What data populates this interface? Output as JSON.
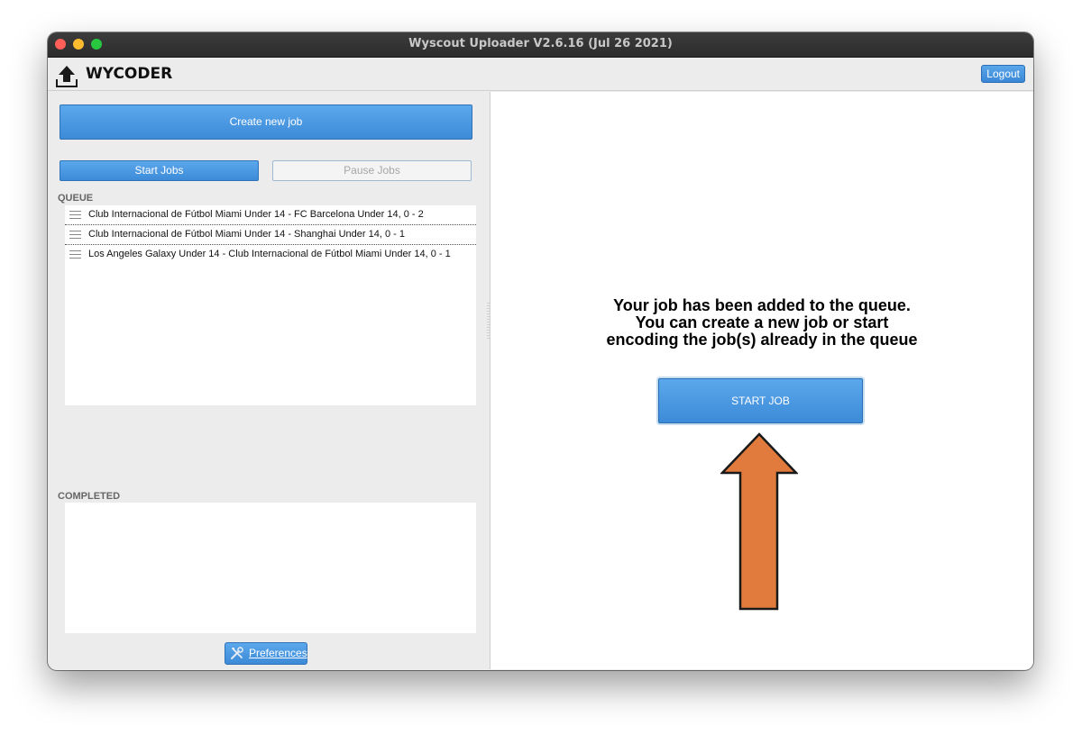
{
  "window": {
    "title": "Wyscout Uploader V2.6.16 (Jul 26 2021)"
  },
  "header": {
    "app_name": "WYCODER",
    "logo_icon": "upload-icon",
    "logout_label": "Logout"
  },
  "left_panel": {
    "create_job_label": "Create new job",
    "start_jobs_label": "Start Jobs",
    "pause_jobs_label": "Pause Jobs",
    "queue_label": "QUEUE",
    "queue_items": [
      {
        "label": "Club Internacional de Fútbol Miami Under 14 - FC Barcelona Under 14, 0 - 2"
      },
      {
        "label": "Club Internacional de Fútbol Miami Under 14 - Shanghai Under 14, 0 - 1"
      },
      {
        "label": "Los Angeles Galaxy Under 14 - Club Internacional de Fútbol Miami Under 14, 0 - 1"
      }
    ],
    "completed_label": "COMPLETED",
    "completed_items": [],
    "preferences_label": "Preferences",
    "preferences_icon": "tools-icon"
  },
  "right_panel": {
    "message_lines": [
      "Your job has been added to the queue.",
      "You can create a new job or start",
      "encoding the job(s) already in the queue"
    ],
    "start_job_label": "START JOB",
    "arrow_icon": "arrow-up-icon",
    "arrow_color": "#e07a3d"
  },
  "colors": {
    "accent_blue": "#3d8ad8",
    "titlebar": "#2c2c2c"
  }
}
